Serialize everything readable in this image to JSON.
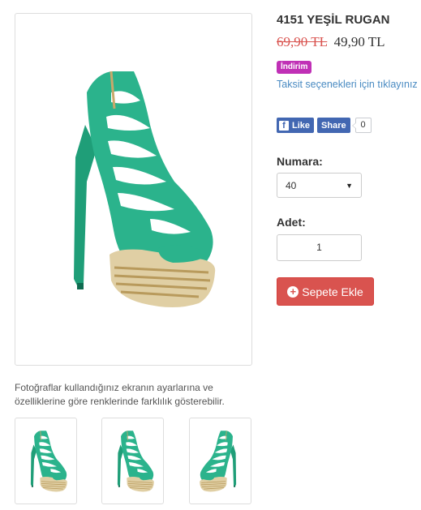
{
  "product": {
    "title": "4151 YEŞİL RUGAN",
    "old_price": "69,90 TL",
    "new_price": "49,90 TL",
    "badge": "İndirim",
    "installment_link": "Taksit seçenekleri için tıklayınız"
  },
  "social": {
    "like_label": "Like",
    "share_label": "Share",
    "share_count": "0",
    "fb_icon": "f"
  },
  "options": {
    "size_label": "Numara:",
    "size_value": "40",
    "quantity_label": "Adet:",
    "quantity_value": "1"
  },
  "cart": {
    "add_label": "Sepete Ekle"
  },
  "gallery": {
    "note": "Fotoğraflar kullandığınız ekranın ayarlarına ve özelliklerine göre renklerinde farklılık gösterebilir."
  },
  "colors": {
    "shoe_green": "#2bb38c",
    "badge": "#c030b6",
    "cart_button": "#d9534f",
    "facebook": "#4267b2",
    "link": "#4a8bc2"
  }
}
